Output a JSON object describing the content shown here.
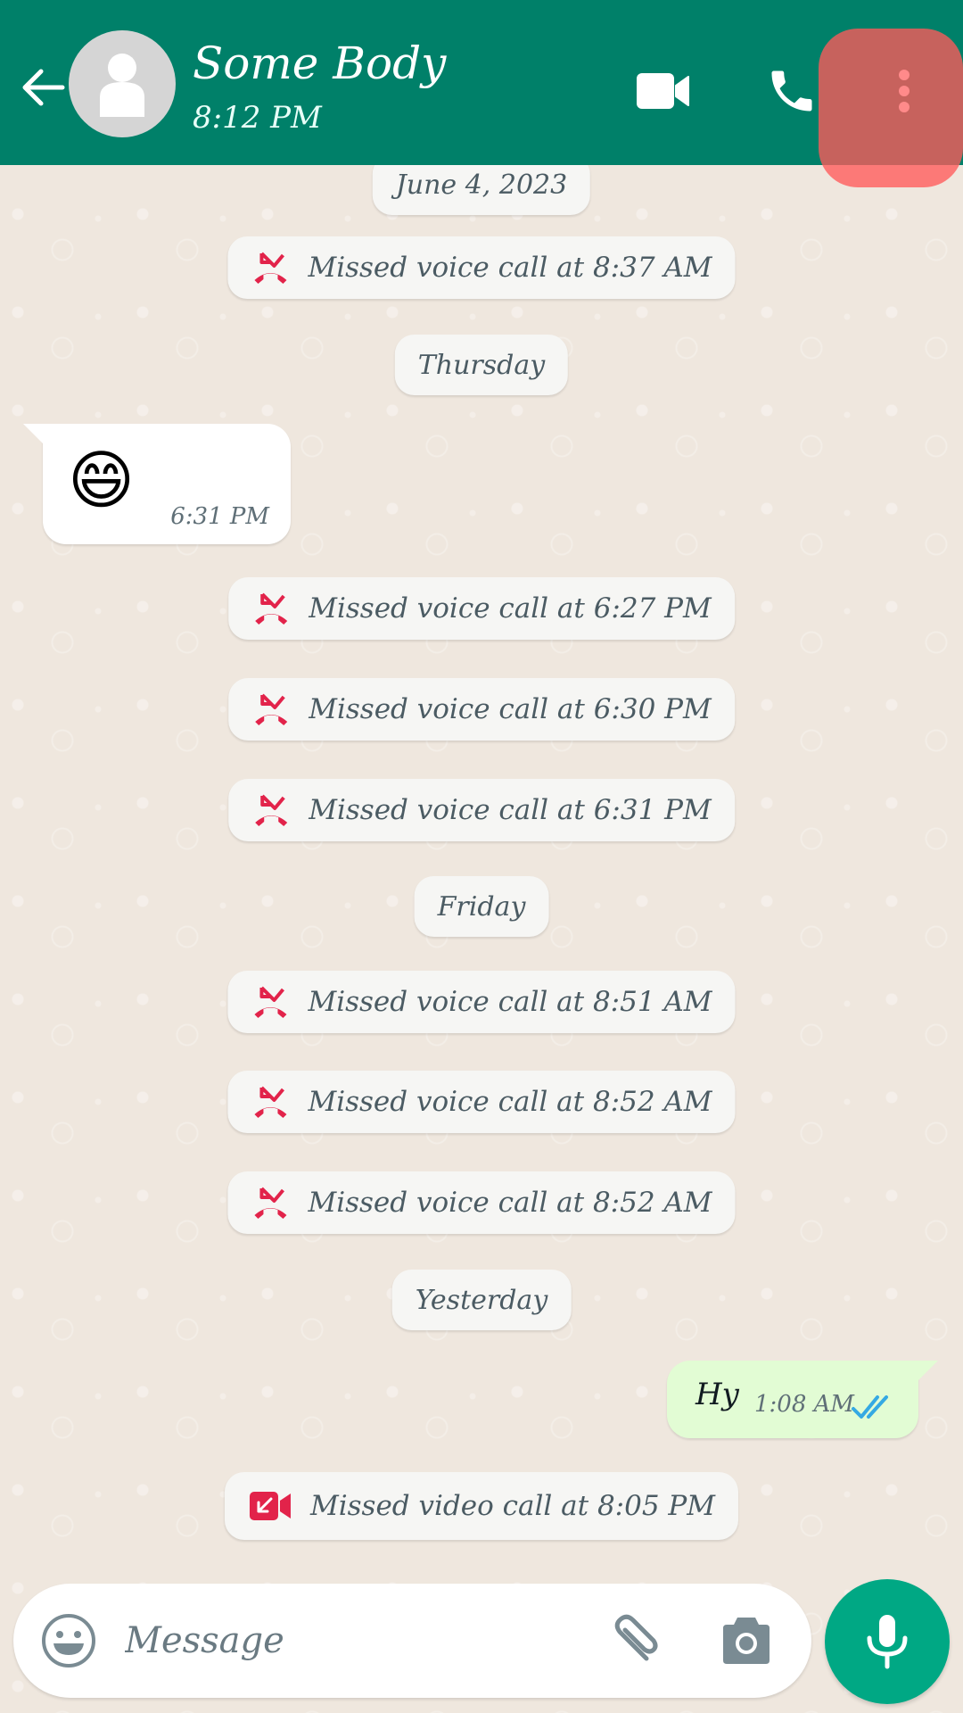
{
  "header": {
    "contact_name": "Some Body",
    "status": "8:12 PM",
    "back_icon": "arrow-left-icon",
    "avatar_icon": "default-person-avatar",
    "actions": [
      {
        "name": "video-call",
        "icon": "video-camera-icon"
      },
      {
        "name": "voice-call",
        "icon": "phone-icon"
      },
      {
        "name": "more-options",
        "icon": "three-dot-vertical-icon",
        "highlighted": true
      }
    ]
  },
  "colors": {
    "header": "#008069",
    "wallpaper": "#efe7de",
    "missed_call_red": "#e2234a",
    "outgoing_bubble": "#e2fcd4",
    "read_ticks": "#35a9e3",
    "mic_button": "#00a884",
    "menu_highlight": "#ff5a5a"
  },
  "chat": {
    "items": [
      {
        "type": "date",
        "text": "June 4, 2023"
      },
      {
        "type": "missed_call",
        "kind": "voice",
        "text": "Missed voice call at 8:37 AM"
      },
      {
        "type": "date",
        "text": "Thursday"
      },
      {
        "type": "incoming",
        "content": "😄",
        "time": "6:31 PM"
      },
      {
        "type": "missed_call",
        "kind": "voice",
        "text": "Missed voice call at 6:27 PM"
      },
      {
        "type": "missed_call",
        "kind": "voice",
        "text": "Missed voice call at 6:30 PM"
      },
      {
        "type": "missed_call",
        "kind": "voice",
        "text": "Missed voice call at 6:31 PM"
      },
      {
        "type": "date",
        "text": "Friday"
      },
      {
        "type": "missed_call",
        "kind": "voice",
        "text": "Missed voice call at 8:51 AM"
      },
      {
        "type": "missed_call",
        "kind": "voice",
        "text": "Missed voice call at 8:52 AM"
      },
      {
        "type": "missed_call",
        "kind": "voice",
        "text": "Missed voice call at 8:52 AM"
      },
      {
        "type": "date",
        "text": "Yesterday"
      },
      {
        "type": "outgoing",
        "content": "Hy",
        "time": "1:08 AM",
        "status": "read"
      },
      {
        "type": "missed_call",
        "kind": "video",
        "text": "Missed video call at 8:05 PM"
      }
    ]
  },
  "composer": {
    "placeholder": "Message",
    "value": "",
    "emoji_icon": "smiley-icon",
    "attach_icon": "paperclip-icon",
    "camera_icon": "camera-icon",
    "mic_icon": "microphone-icon"
  }
}
